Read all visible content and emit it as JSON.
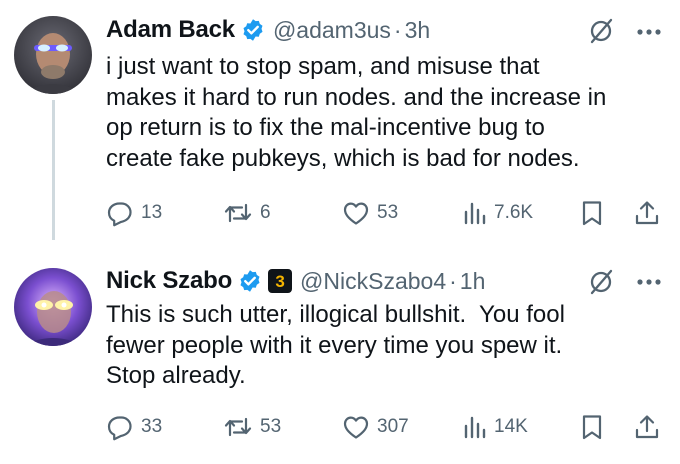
{
  "tweets": [
    {
      "author": {
        "name": "Adam Back",
        "handle": "@adam3us",
        "time": "3h"
      },
      "text_lines": [
        "i just want to stop spam, and misuse that",
        "makes it hard to run nodes. and the increase in",
        "op return is to fix the mal-incentive bug to",
        "create fake pubkeys, which is bad for nodes."
      ],
      "stats": {
        "replies": "13",
        "reposts": "6",
        "likes": "53",
        "views": "7.6K"
      }
    },
    {
      "author": {
        "name": "Nick Szabo",
        "handle": "@NickSzabo4",
        "time": "1h",
        "affiliate_badge": "3"
      },
      "text_lines": [
        "This is such utter, illogical bullshit.  You fool",
        "fewer people with it every time you spew it.",
        "Stop already."
      ],
      "stats": {
        "replies": "33",
        "reposts": "53",
        "likes": "307",
        "views": "14K"
      }
    }
  ],
  "separator": "·",
  "icons": {
    "verified": "verified-badge-icon",
    "grok": "grok-icon",
    "more": "more-icon",
    "reply": "reply-icon",
    "repost": "repost-icon",
    "like": "like-icon",
    "views": "views-icon",
    "bookmark": "bookmark-icon",
    "share": "share-icon"
  },
  "colors": {
    "text": "#0f1419",
    "secondary": "#536471",
    "verified": "#1d9bf0",
    "thread_line": "#cfd9de",
    "affiliate_bg": "#0f1419",
    "affiliate_fg": "#f4b400"
  }
}
